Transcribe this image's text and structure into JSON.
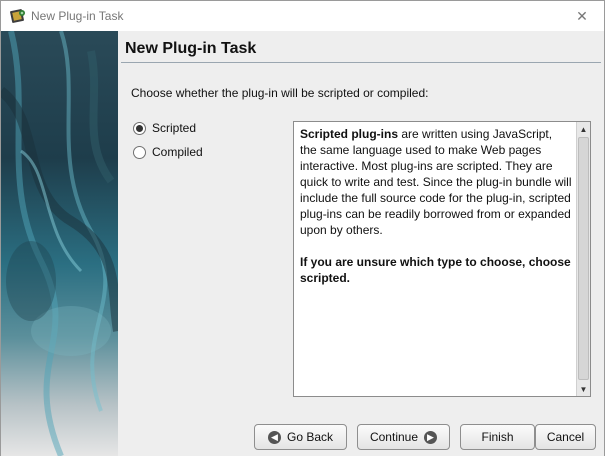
{
  "window": {
    "title": "New Plug-in Task",
    "close_glyph": "✕",
    "app_icon": "plugin-film-icon"
  },
  "page": {
    "heading": "New Plug-in Task",
    "prompt": "Choose whether the plug-in will be scripted or compiled:"
  },
  "options": {
    "scripted": {
      "label": "Scripted",
      "selected": true
    },
    "compiled": {
      "label": "Compiled",
      "selected": false
    }
  },
  "description": {
    "para1_bold": "Scripted plug-ins",
    "para1_rest": " are written using JavaScript, the same language used to make Web pages interactive. Most plug-ins are scripted. They are quick to write and test. Since the plug-in bundle will include the full source code for the plug-in, scripted plug-ins can be readily borrowed from or expanded upon by others.",
    "para2": "If you are unsure which type to choose, choose scripted."
  },
  "buttons": {
    "back": "Go Back",
    "continue": "Continue",
    "finish": "Finish",
    "cancel": "Cancel"
  }
}
